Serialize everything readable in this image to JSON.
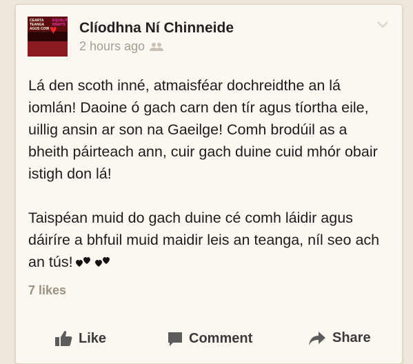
{
  "post": {
    "author": "Clíodhna Ní Chinneide",
    "timestamp": "2 hours ago",
    "paragraphs": [
      "Lá den scoth inné, atmaisféar dochreidthe an lá iomlán! Daoine ó gach carn den tír agus tíortha eile, uillig ansin ar son na Gaeilge! Comh brodúil as a bheith páirteach ann, cuir gach duine cuid mhór obair istigh don lá!",
      "Taispéan muid do gach duine cé comh láidir agus dáiríre a bhfuil muid maidir leis an teanga, níl seo ach an tús!"
    ],
    "likes": "7 likes"
  },
  "avatar": {
    "text_left": "CEARTA TEANGA AGUS COIR",
    "text_right": "EQUALITY RIGHTS"
  },
  "actions": {
    "like": "Like",
    "comment": "Comment",
    "share": "Share"
  },
  "icons": {
    "audience": "friends-icon",
    "options": "chevron-down-icon",
    "like": "thumbs-up-icon",
    "comment": "comment-icon",
    "share": "share-arrow-icon"
  }
}
